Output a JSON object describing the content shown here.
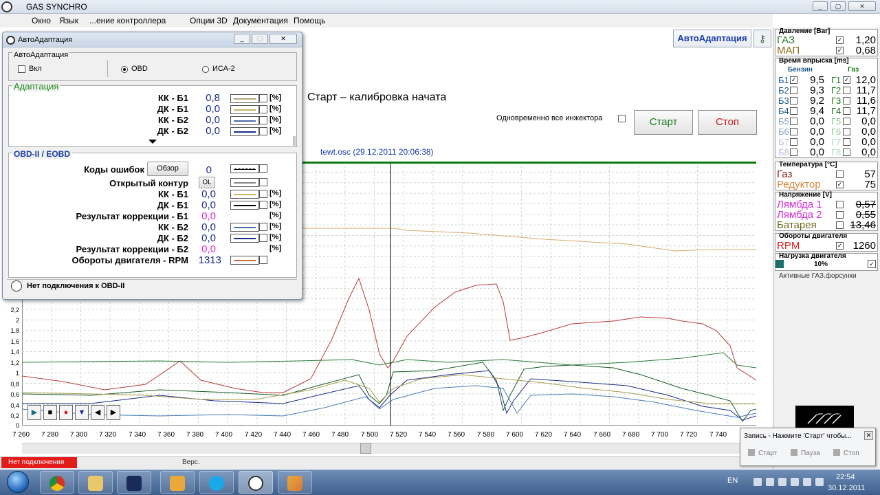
{
  "app": {
    "title": "GAS SYNCHRO",
    "controls": [
      "_",
      "▢",
      "✕"
    ]
  },
  "menu": [
    "Окно",
    "Язык",
    "...ение контроллера",
    "Опции 3D",
    "Документация",
    "Помощь"
  ],
  "header": {
    "autoadapt_label": "АвтоАдаптация",
    "calibration_text": "Старт – калибровка начата",
    "simultaneous_label": "Одновременно все инжектора",
    "start_label": "Старт",
    "stop_label": "Стоп"
  },
  "graph": {
    "title": "tewt.osc   (29.12.2011 20:06:38)",
    "y_ticks": [
      "2,2",
      "2",
      "1,8",
      "1,6",
      "1,4",
      "1,2",
      "1",
      "0,8",
      "0,6",
      "0,4",
      "0,2",
      "0"
    ],
    "x_ticks": [
      "7 260",
      "7 280",
      "7 300",
      "7 320",
      "7 340",
      "7 360",
      "7 380",
      "7 400",
      "7 420",
      "7 440",
      "7 460",
      "7 480",
      "7 500",
      "7 520",
      "7 540",
      "7 560",
      "7 580",
      "7 600",
      "7 620",
      "7 640",
      "7 660",
      "7 680",
      "7 700",
      "7 720",
      "7 740"
    ],
    "controls": [
      "▶",
      "■",
      "●",
      "▼",
      "◀",
      "▶"
    ]
  },
  "status": {
    "no_connection": "Нет подключения",
    "version": "Верс."
  },
  "right_panel": {
    "pressure_head": "Давление [Bar]",
    "pressure": [
      {
        "label": "ГАЗ",
        "checked": "✓",
        "value": "1,20",
        "color": "#2a7a2a"
      },
      {
        "label": "МАП",
        "checked": "✓",
        "value": "0,68",
        "color": "#8a6a1a"
      }
    ],
    "injection_head": "Время впрыска [ms]",
    "petrol_label": "Бензин",
    "gas_label": "Газ",
    "injectors": [
      {
        "b": "Б1",
        "bc": "✓",
        "bv": "9,5",
        "g": "Г1",
        "gc": "✓",
        "gv": "12,0"
      },
      {
        "b": "Б2",
        "bc": "",
        "bv": "9,3",
        "g": "Г2",
        "gc": "",
        "gv": "11,7"
      },
      {
        "b": "Б3",
        "bc": "",
        "bv": "9,2",
        "g": "Г3",
        "gc": "",
        "gv": "11,6"
      },
      {
        "b": "Б4",
        "bc": "",
        "bv": "9,4",
        "g": "Г4",
        "gc": "",
        "gv": "11,7"
      },
      {
        "b": "Б5",
        "bc": "",
        "bv": "0,0",
        "g": "Г5",
        "gc": "",
        "gv": "0,0"
      },
      {
        "b": "Б6",
        "bc": "",
        "bv": "0,0",
        "g": "Г6",
        "gc": "",
        "gv": "0,0"
      },
      {
        "b": "Б7",
        "bc": "",
        "bv": "0,0",
        "g": "Г7",
        "gc": "",
        "gv": "0,0"
      },
      {
        "b": "Б8",
        "bc": "",
        "bv": "0,0",
        "g": "Г8",
        "gc": "",
        "gv": "0,0"
      }
    ],
    "temp_head": "Температура [°C]",
    "temps": [
      {
        "label": "Газ",
        "checked": "",
        "value": "57",
        "color": "#8a1a1a"
      },
      {
        "label": "Редуктор",
        "checked": "✓",
        "value": "75",
        "color": "#d8883a"
      }
    ],
    "voltage_head": "Напряжение [V]",
    "voltages": [
      {
        "label": "Лямбда 1",
        "checked": "",
        "value": "0,57",
        "color": "#d82ad8"
      },
      {
        "label": "Лямбда 2",
        "checked": "",
        "value": "0,55",
        "color": "#d82ad8"
      },
      {
        "label": "Батарея",
        "checked": "",
        "value": "13,46",
        "color": "#6a6a1a"
      }
    ],
    "rpm_head": "Обороты двигателя",
    "rpm_label": "RPM",
    "rpm_checked": "✓",
    "rpm_value": "1260",
    "load_head": "Нагрузка двигателя",
    "load_value": "10%",
    "load_checked": "✓",
    "active_injectors": "Активные ГАЗ.форсунки"
  },
  "record_popup": {
    "title": "Запись - Нажмите 'Старт' чтобы...",
    "start": "Старт",
    "pause": "Пауза",
    "stop": "Стоп"
  },
  "dialog": {
    "title": "АвтоАдаптация",
    "group1_title": "АвтоАдаптация",
    "on_label": "Вкл",
    "obd_label": "OBD",
    "isa_label": "ИСА-2",
    "adapt_title": "Адаптация",
    "adapt_rows": [
      {
        "label": "КК - Б1",
        "value": "0,8",
        "unit": "[%]",
        "line": "#c8b46a"
      },
      {
        "label": "ДК - Б1",
        "value": "0,0",
        "unit": "[%]",
        "line": "#c8b46a"
      },
      {
        "label": "КК - Б2",
        "value": "0,0",
        "unit": "[%]",
        "line": "#1a2a8a"
      },
      {
        "label": "ДК - Б2",
        "value": "0,0",
        "unit": "[%]",
        "line": "#1a2a8a"
      }
    ],
    "obd_title": "OBD-II / EOBD",
    "error_codes_label": "Коды ошибок",
    "browse_label": "Обзор",
    "error_codes_value": "0",
    "open_loop_label": "Открытый контур",
    "open_loop_value": "OL",
    "obd_rows": [
      {
        "label": "КК - Б1",
        "value": "0,0",
        "unit": "[%]",
        "line": "#c8b46a",
        "magenta": false
      },
      {
        "label": "ДК - Б1",
        "value": "0,0",
        "unit": "[%]",
        "line": "#000000",
        "magenta": false
      },
      {
        "label": "Результат коррекции - Б1",
        "value": "0,0",
        "unit": "[%]",
        "line": "",
        "magenta": true
      },
      {
        "label": "КК - Б2",
        "value": "0,0",
        "unit": "[%]",
        "line": "#4a6aaa",
        "magenta": false
      },
      {
        "label": "ДК - Б2",
        "value": "0,0",
        "unit": "[%]",
        "line": "#1a2a8a",
        "magenta": false
      },
      {
        "label": "Результат коррекции - Б2",
        "value": "0,0",
        "unit": "[%]",
        "line": "",
        "magenta": true
      },
      {
        "label": "Обороты двигателя - RPM",
        "value": "1313",
        "unit": "",
        "line": "#c86a3a",
        "magenta": false
      }
    ],
    "no_obd": "Нет подключения к OBD-II"
  },
  "taskbar": {
    "lang": "EN",
    "time": "22:54",
    "date": "30.12.2011"
  }
}
